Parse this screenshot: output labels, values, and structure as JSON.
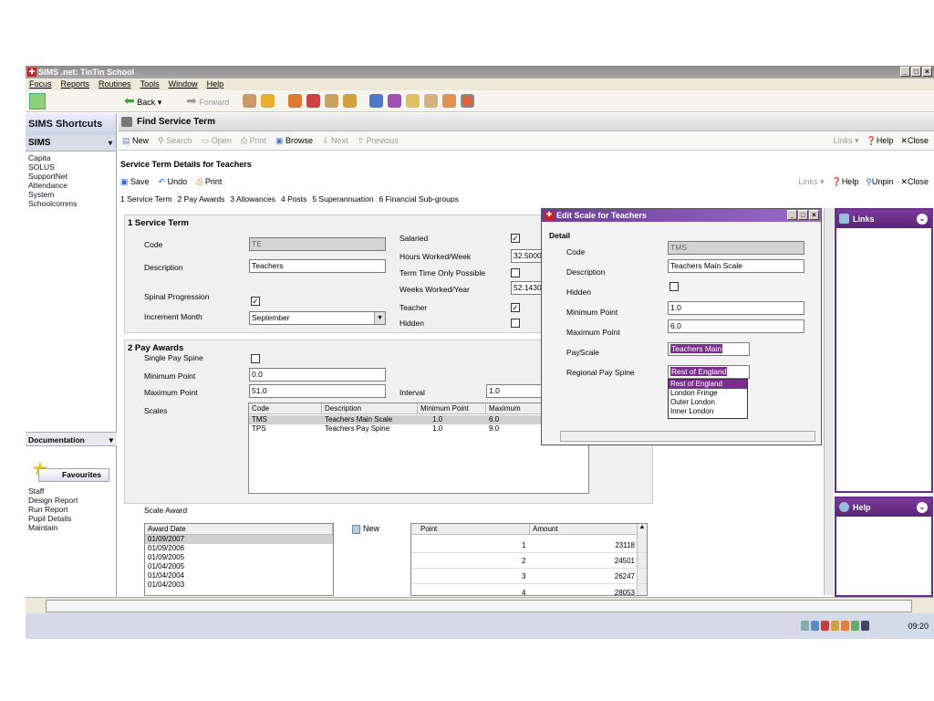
{
  "app": {
    "title": "SIMS .net: TinTin School",
    "window_buttons": [
      "_",
      "□",
      "×"
    ]
  },
  "menu": [
    "Focus",
    "Reports",
    "Routines",
    "Tools",
    "Window",
    "Help"
  ],
  "toolbar": {
    "back_label": "Back",
    "forward_label": "Forward"
  },
  "sidebar": {
    "title": "SIMS Shortcuts",
    "selected": "SIMS",
    "items": [
      "Capita",
      "SOLUS",
      "SupportNet",
      "Attendance",
      "System",
      "Schoolcomms"
    ],
    "doc_label": "Documentation",
    "fav_label": "Favourites",
    "fav_items": [
      "Staff",
      "Design Report",
      "Run Report",
      "Pupil Details",
      "Maintain"
    ]
  },
  "find": {
    "title": "Find Service Term",
    "buttons": [
      "New",
      "Search",
      "Open",
      "Print",
      "Browse",
      "Next",
      "Previous"
    ],
    "right": [
      "Links",
      "Help",
      "Close"
    ]
  },
  "detail": {
    "title": "Service Term Details for Teachers",
    "buttons": [
      "Save",
      "Undo",
      "Print"
    ],
    "right": [
      "Links",
      "Help",
      "Unpin",
      "Close"
    ],
    "tabs": [
      "1 Service Term",
      "2 Pay Awards",
      "3 Allowances",
      "4 Posts",
      "5 Superannuation",
      "6 Financial Sub-groups"
    ]
  },
  "service_term": {
    "heading": "1 Service Term",
    "code_label": "Code",
    "code_value": "TE",
    "desc_label": "Description",
    "desc_value": "Teachers",
    "spinal_label": "Spinal Progression",
    "increment_label": "Increment Month",
    "increment_value": "September",
    "salaried_label": "Salaried",
    "hours_label": "Hours Worked/Week",
    "hours_value": "32.5000",
    "ttop_label": "Term Time Only Possible",
    "weeks_label": "Weeks Worked/Year",
    "weeks_value": "52.1430",
    "teacher_label": "Teacher",
    "hidden_label": "Hidden"
  },
  "pay_awards": {
    "heading": "2 Pay Awards",
    "single_label": "Single Pay Spine",
    "min_label": "Minimum Point",
    "min_value": "0.0",
    "max_label": "Maximum Point",
    "max_value": "51.0",
    "interval_label": "Interval",
    "interval_value": "1.0",
    "scales_label": "Scales",
    "scales_cols": [
      "Code",
      "Description",
      "Minimum Point",
      "Maximum"
    ],
    "scales_rows": [
      {
        "code": "TMS",
        "desc": "Teachers Main Scale",
        "min": "1.0",
        "max": "6.0"
      },
      {
        "code": "TPS",
        "desc": "Teachers Pay Spine",
        "min": "1.0",
        "max": "9.0"
      }
    ],
    "scale_award_label": "Scale Award",
    "award_col": "Award Date",
    "award_dates": [
      "01/09/2007",
      "01/09/2006",
      "01/09/2005",
      "01/04/2005",
      "01/04/2004",
      "01/04/2003"
    ],
    "new_label": "New",
    "point_col": "Point",
    "amount_col": "Amount",
    "points": [
      {
        "point": "1",
        "amount": "23118"
      },
      {
        "point": "2",
        "amount": "24501"
      },
      {
        "point": "3",
        "amount": "26247"
      },
      {
        "point": "4",
        "amount": "28053"
      }
    ]
  },
  "edit_scale": {
    "title": "Edit Scale for Teachers",
    "detail_label": "Detail",
    "code_label": "Code",
    "code_value": "TMS",
    "desc_label": "Description",
    "desc_value": "Teachers Main Scale",
    "hidden_label": "Hidden",
    "min_label": "Minimum Point",
    "min_value": "1.0",
    "max_label": "Maximum Point",
    "max_value": "6.0",
    "payscale_label": "PayScale",
    "payscale_value": "Teachers Main",
    "rps_label": "Regional Pay Spine",
    "rps_value": "Rest of England",
    "rps_options": [
      "Rest of England",
      "London Fringe",
      "Outer London",
      "Inner London"
    ]
  },
  "links_pane": {
    "title": "Links"
  },
  "help_pane": {
    "title": "Help"
  },
  "tray": {
    "time": "09:20"
  },
  "colors": {
    "accent": "#6a2f8a",
    "callout": "#7b2e8e"
  }
}
